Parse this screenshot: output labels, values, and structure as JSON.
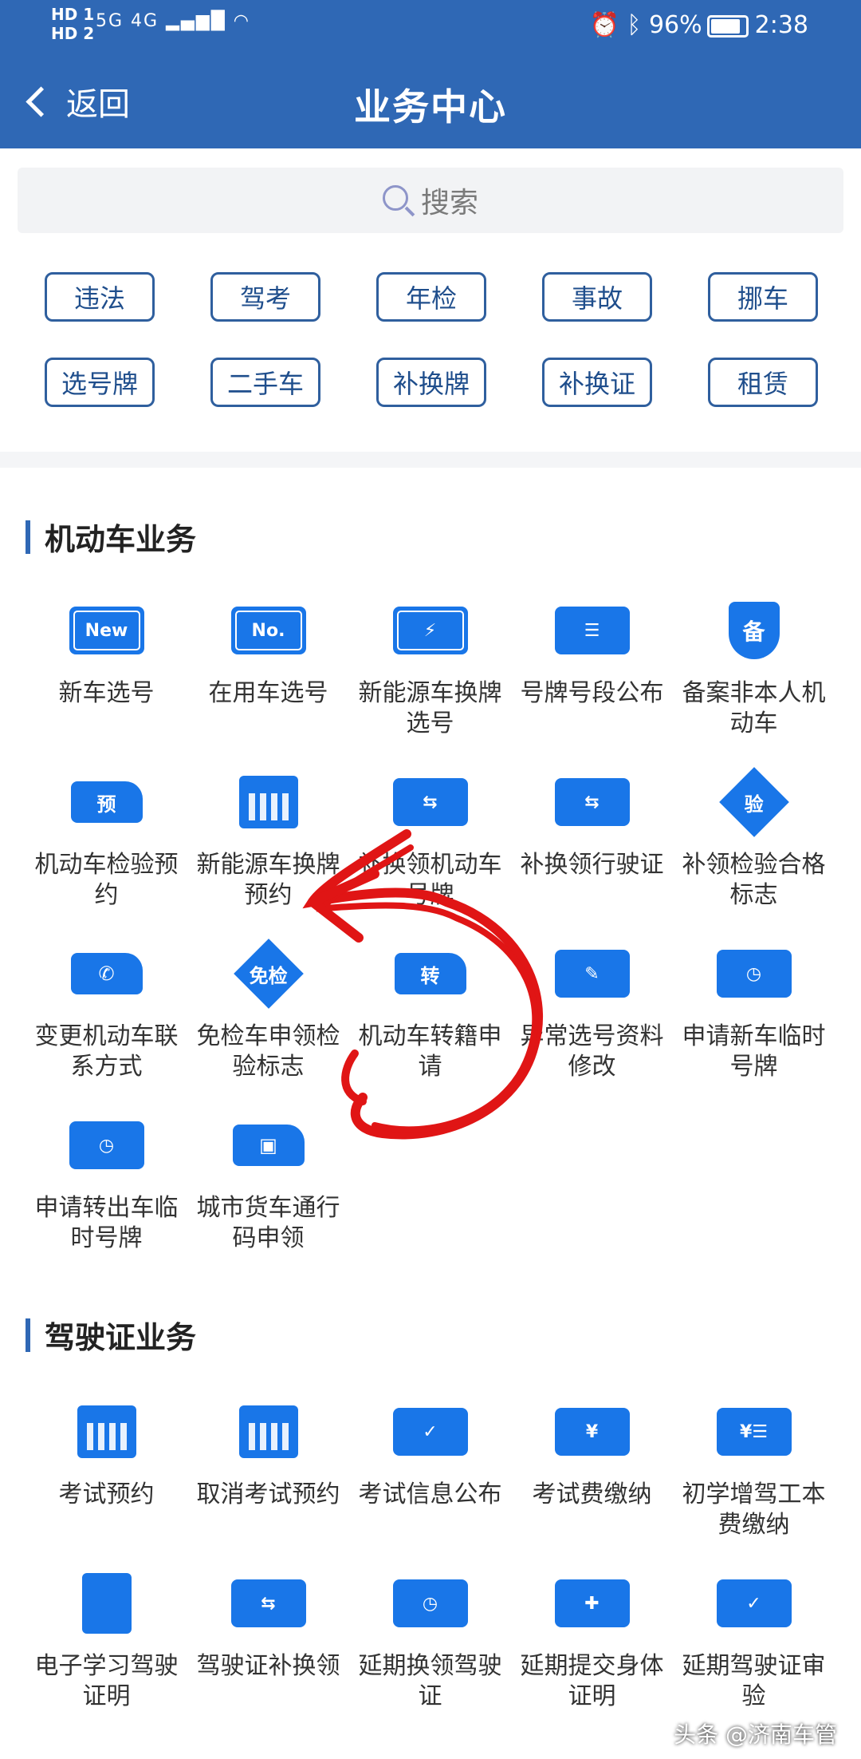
{
  "status": {
    "hd1": "HD 1",
    "hd2": "HD 2",
    "signal": "5G 4G",
    "battery": "96%",
    "time": "2:38"
  },
  "header": {
    "back_label": "返回",
    "title": "业务中心"
  },
  "search": {
    "placeholder": "搜索"
  },
  "quick_tags": [
    "违法",
    "驾考",
    "年检",
    "事故",
    "挪车",
    "选号牌",
    "二手车",
    "补换牌",
    "补换证",
    "租赁"
  ],
  "sections": [
    {
      "title": "机动车业务",
      "items": [
        {
          "label": "新车选号",
          "icon": "new-plate-icon",
          "glyph": "New"
        },
        {
          "label": "在用车选号",
          "icon": "no-plate-icon",
          "glyph": "No."
        },
        {
          "label": "新能源车换牌选号",
          "icon": "ev-plate-icon",
          "glyph": "⚡"
        },
        {
          "label": "号牌号段公布",
          "icon": "notice-board-icon",
          "glyph": "☰"
        },
        {
          "label": "备案非本人机动车",
          "icon": "shield-icon",
          "glyph": "备"
        },
        {
          "label": "机动车检验预约",
          "icon": "truck-booking-icon",
          "glyph": "预"
        },
        {
          "label": "新能源车换牌预约",
          "icon": "ev-calendar-icon",
          "glyph": "⚡"
        },
        {
          "label": "补换领机动车号牌",
          "icon": "swap-plate-icon",
          "glyph": "⇆"
        },
        {
          "label": "补换领行驶证",
          "icon": "swap-license-icon",
          "glyph": "⇆"
        },
        {
          "label": "补领检验合格标志",
          "icon": "inspection-diamond-icon",
          "glyph": "验"
        },
        {
          "label": "变更机动车联系方式",
          "icon": "truck-phone-icon",
          "glyph": "✆"
        },
        {
          "label": "免检车申领检验标志",
          "icon": "exempt-diamond-icon",
          "glyph": "免检"
        },
        {
          "label": "机动车转籍申请",
          "icon": "truck-transfer-icon",
          "glyph": "转"
        },
        {
          "label": "异常选号资料修改",
          "icon": "edit-plate-icon",
          "glyph": "✎"
        },
        {
          "label": "申请新车临时号牌",
          "icon": "temp-plate-icon",
          "glyph": "◷"
        },
        {
          "label": "申请转出车临时号牌",
          "icon": "temp-plate-out-icon",
          "glyph": "◷"
        },
        {
          "label": "城市货车通行码申领",
          "icon": "truck-pass-icon",
          "glyph": "▣"
        }
      ]
    },
    {
      "title": "驾驶证业务",
      "items": [
        {
          "label": "考试预约",
          "icon": "calendar-icon",
          "glyph": ""
        },
        {
          "label": "取消考试预约",
          "icon": "calendar-cancel-icon",
          "glyph": ""
        },
        {
          "label": "考试信息公布",
          "icon": "notice-check-icon",
          "glyph": "✓"
        },
        {
          "label": "考试费缴纳",
          "icon": "receipt-yen-icon",
          "glyph": "¥"
        },
        {
          "label": "初学增驾工本费缴纳",
          "icon": "yen-card-icon",
          "glyph": "¥☰"
        },
        {
          "label": "电子学习驾驶证明",
          "icon": "document-icon",
          "glyph": ""
        },
        {
          "label": "驾驶证补换领",
          "icon": "id-swap-icon",
          "glyph": "⇆"
        },
        {
          "label": "延期换领驾驶证",
          "icon": "id-clock-icon",
          "glyph": "◷"
        },
        {
          "label": "延期提交身体证明",
          "icon": "medical-clock-icon",
          "glyph": "✚"
        },
        {
          "label": "延期驾驶证审验",
          "icon": "id-check-icon",
          "glyph": "✓"
        }
      ]
    }
  ],
  "watermark": "头条 @济南车管",
  "colors": {
    "header_bg": "#2f68b5",
    "icon_blue": "#1976e8",
    "tag_border": "#2f5f9e",
    "annotation_red": "#e01515"
  }
}
